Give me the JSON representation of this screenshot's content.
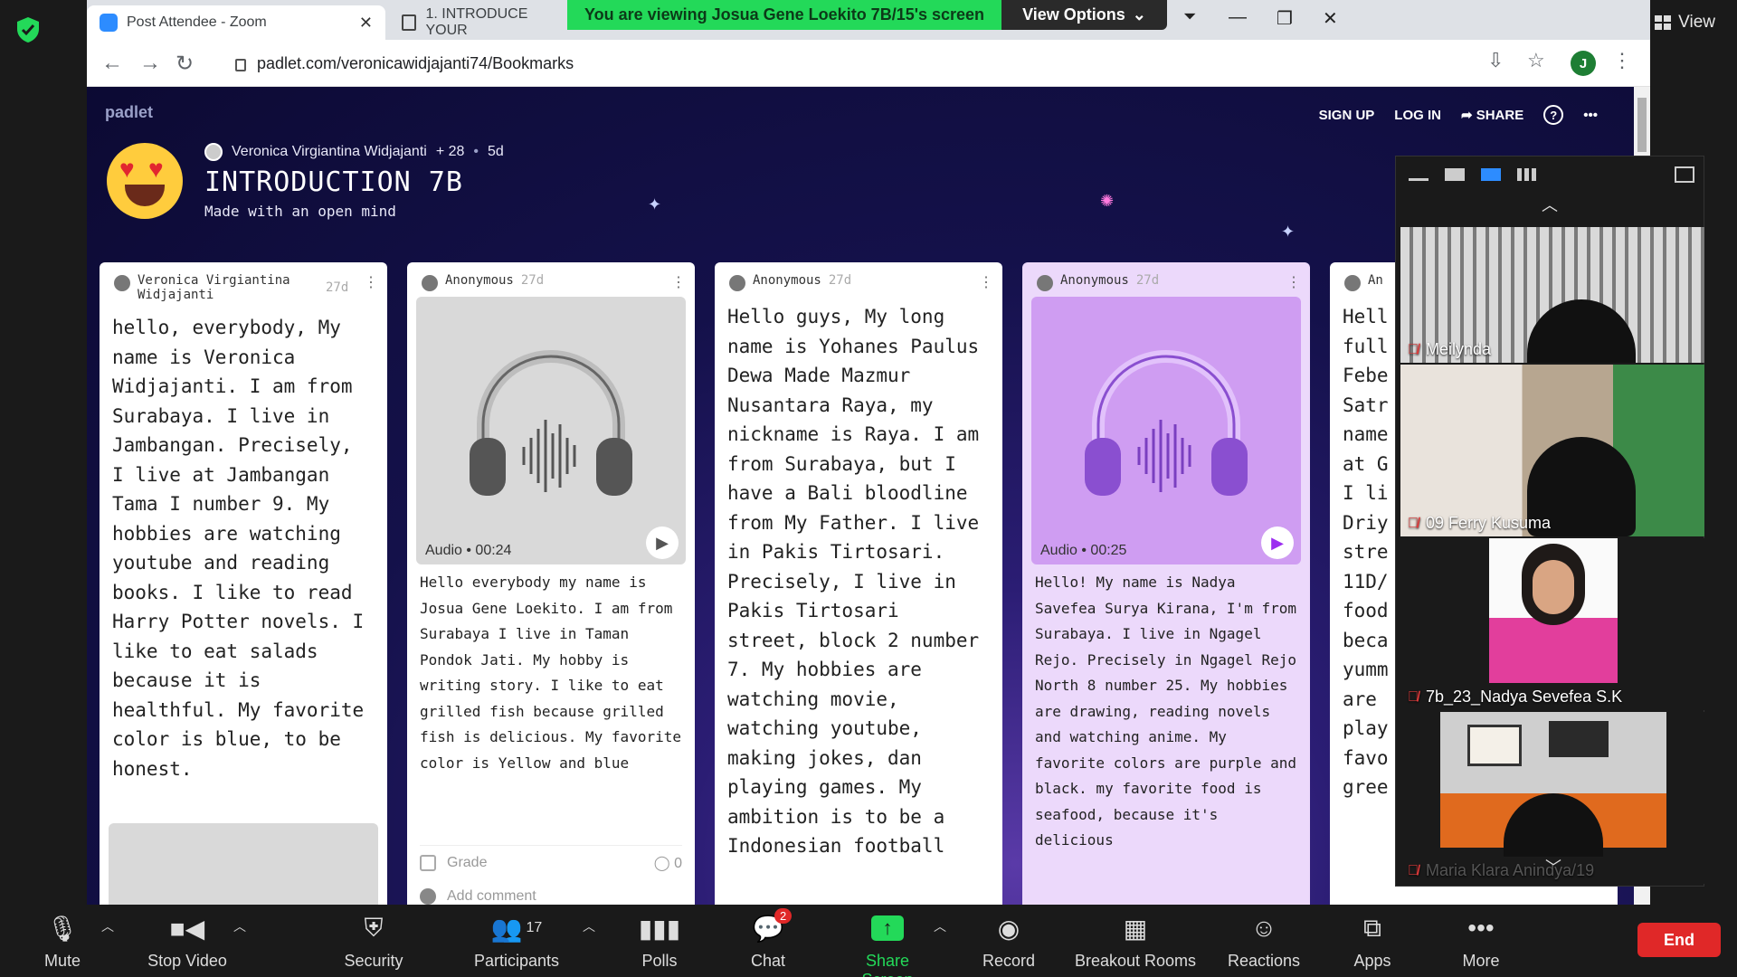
{
  "zoom": {
    "view_label": "View",
    "viewing_banner": "You are viewing Josua Gene Loekito 7B/15's screen",
    "view_options": "View Options",
    "controls": {
      "mute": "Mute",
      "stop_video": "Stop Video",
      "security": "Security",
      "participants": "Participants",
      "participants_count": "17",
      "polls": "Polls",
      "chat": "Chat",
      "chat_badge": "2",
      "share_screen": "Share Screen",
      "record": "Record",
      "breakout_rooms": "Breakout Rooms",
      "reactions": "Reactions",
      "apps": "Apps",
      "more": "More",
      "end": "End"
    },
    "participants_tiles": [
      {
        "name": "Meilynda"
      },
      {
        "name": "09 Ferry Kusuma"
      },
      {
        "name": "7b_23_Nadya Sevefea S.K"
      },
      {
        "name": "Maria Klara Anindya/19"
      }
    ],
    "colors": {
      "share_green": "#23d959",
      "end_red": "#e02828"
    }
  },
  "browser": {
    "tabs": [
      {
        "title": "Post Attendee - Zoom"
      },
      {
        "title": "1. INTRODUCE YOUR"
      }
    ],
    "url": "padlet.com/veronicawidjajanti74/Bookmarks",
    "profile_initial": "J"
  },
  "padlet": {
    "logo": "padlet",
    "links": {
      "signup": "SIGN UP",
      "login": "LOG IN",
      "share": "SHARE"
    },
    "author": "Veronica Virgiantina Widjajanti",
    "likes": "+ 28",
    "age": "5d",
    "title": "INTRODUCTION 7B",
    "subtitle": "Made with an open mind",
    "cards": [
      {
        "author": "Veronica Virgiantina Widjajanti",
        "age": "27d",
        "body": "hello, everybody, My name is Veronica Widjajanti. I am from Surabaya. I live in Jambangan. Precisely, I live at Jambangan Tama I number 9. My hobbies are watching youtube and reading books. I like to read Harry Potter novels. I like to eat salads because it is healthful. My favorite color is blue, to be honest."
      },
      {
        "author": "Anonymous",
        "age": "27d",
        "audio_label": "Audio • 00:24",
        "body": "Hello everybody my name is Josua Gene Loekito. I am from Surabaya I live in Taman Pondok Jati. My hobby is writing story. I like to eat grilled fish because grilled fish is delicious. My favorite color is Yellow and blue",
        "grade": "Grade",
        "comments": "0",
        "add_comment": "Add comment"
      },
      {
        "author": "Anonymous",
        "age": "27d",
        "body": "Hello guys, My long name is Yohanes Paulus Dewa Made Mazmur Nusantara Raya, my nickname is Raya. I am from Surabaya, but I have a Bali bloodline from My Father. I live in Pakis Tirtosari. Precisely, I live in Pakis Tirtosari street, block 2 number 7. My hobbies are watching movie, watching youtube, making jokes, dan playing games. My ambition is to be a Indonesian football"
      },
      {
        "author": "Anonymous",
        "age": "27d",
        "audio_label": "Audio • 00:25",
        "body": "Hello! My name is Nadya Savefea Surya Kirana, I'm from Surabaya. I live in Ngagel Rejo. Precisely in Ngagel Rejo North 8 number 25. My hobbies are drawing, reading novels and watching anime. My favorite colors are purple and black. my favorite food is seafood, because it's delicious"
      },
      {
        "author": "An",
        "lines": [
          "Hell",
          "full",
          "Febe",
          "Satr",
          "name",
          "at G",
          "I li",
          "Driy",
          "stre",
          "11D/",
          "food",
          "beca",
          "yumm",
          "are",
          "play",
          "favo",
          "gree"
        ]
      }
    ]
  }
}
